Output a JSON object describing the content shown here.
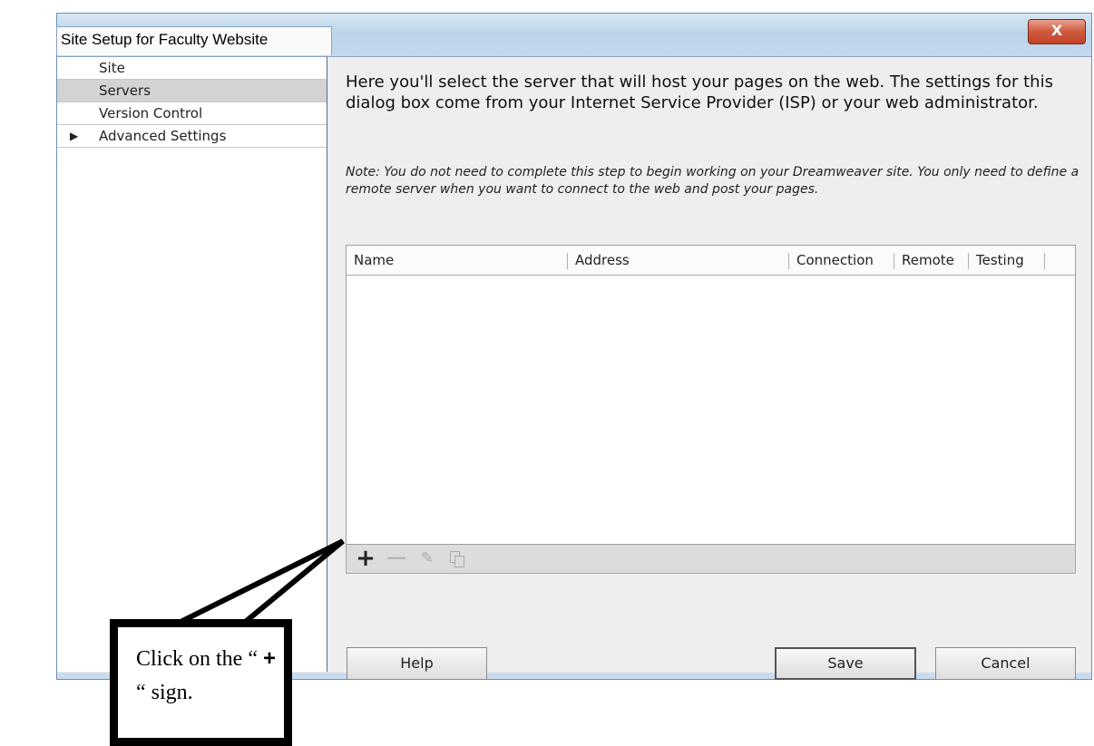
{
  "window": {
    "title": "Site Setup for Faculty Website",
    "close_label": "X"
  },
  "sidebar": {
    "items": [
      {
        "label": "Site"
      },
      {
        "label": "Servers"
      },
      {
        "label": "Version Control"
      },
      {
        "label": "Advanced Settings",
        "arrow": "▶"
      }
    ]
  },
  "main": {
    "intro": "Here you'll select the server that will host your pages on the web. The settings for this dialog box come from your Internet Service Provider (ISP) or your web administrator.",
    "note": "Note: You do not need to complete this step to begin working on your Dreamweaver site. You only need to define a remote server when you want to connect to the web and post your pages."
  },
  "table": {
    "columns": [
      "Name",
      "Address",
      "Connection",
      "Remote",
      "Testing"
    ]
  },
  "toolbar": {
    "add_icon": "plus-icon",
    "remove_icon": "minus-icon",
    "edit_icon": "pencil-icon",
    "duplicate_icon": "duplicate-icon",
    "add_glyph": "+",
    "remove_glyph": "—",
    "edit_glyph": "✎"
  },
  "buttons": {
    "help": "Help",
    "save": "Save",
    "cancel": "Cancel"
  },
  "callout": {
    "before": "Click on the “ ",
    "plus": "+",
    "after": " “ sign."
  }
}
